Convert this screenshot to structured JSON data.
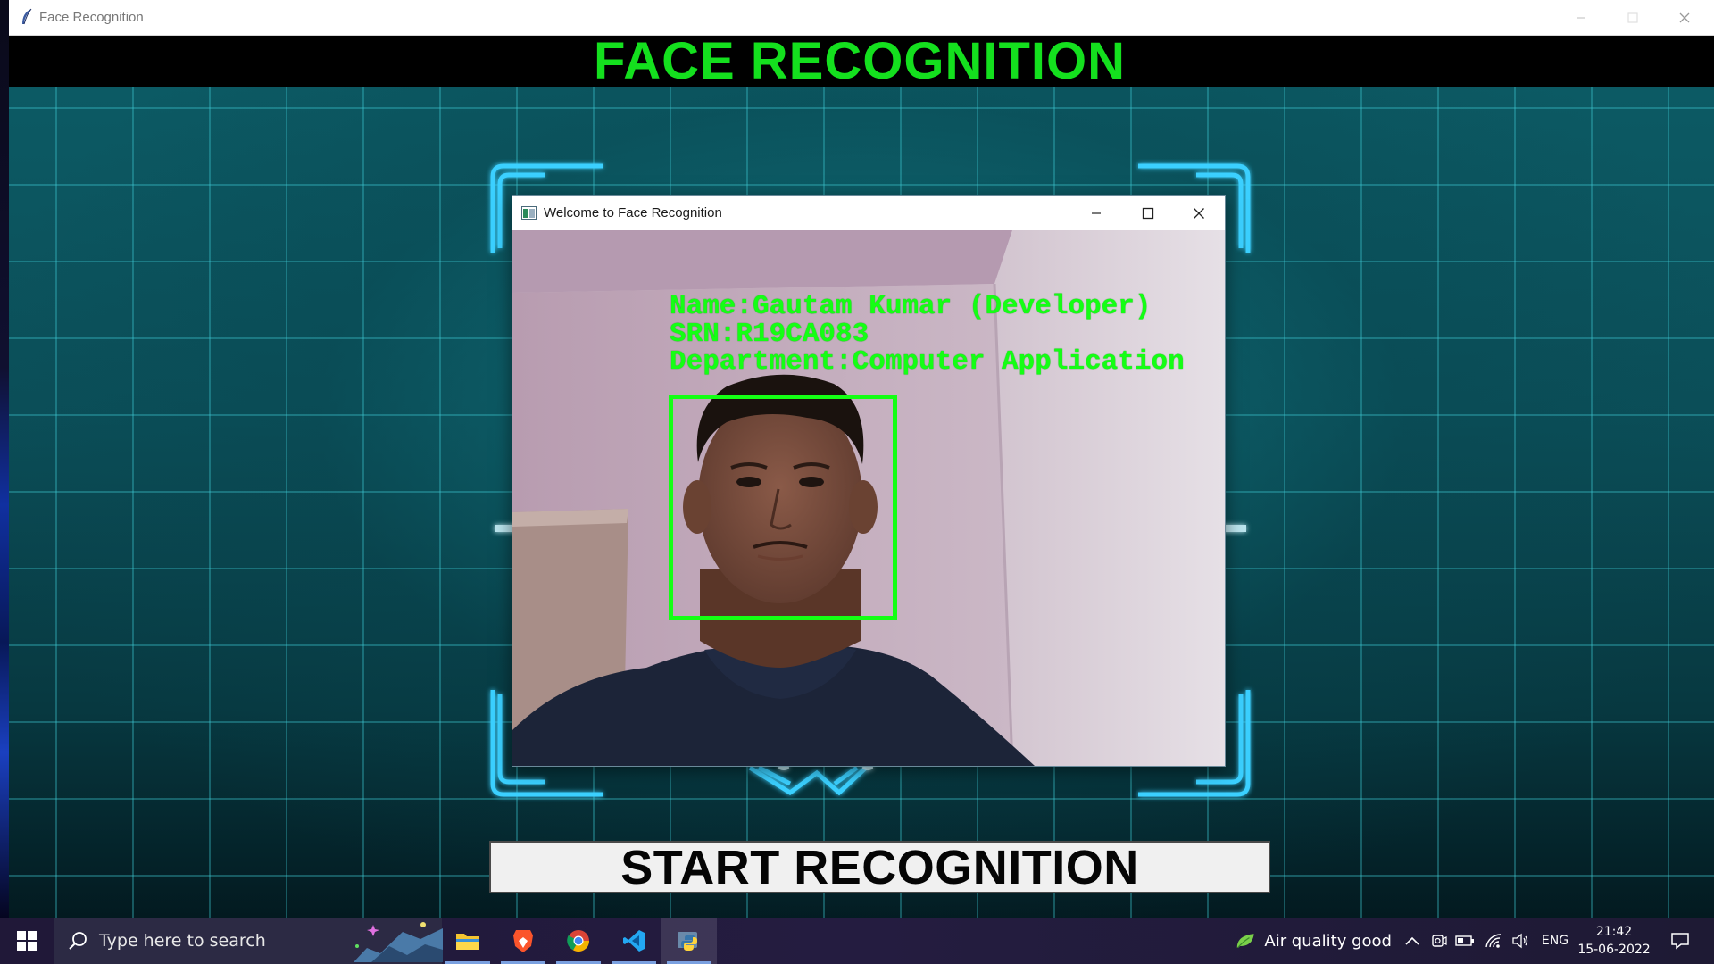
{
  "app_window": {
    "title": "Face Recognition",
    "banner_title": "FACE RECOGNITION",
    "start_button_label": "START RECOGNITION"
  },
  "cam_window": {
    "title": "Welcome to Face Recognition",
    "overlay": {
      "name_line": "Name:Gautam Kumar (Developer)",
      "srn_line": "SRN:R19CA083",
      "department_line": "Department:Computer Application"
    }
  },
  "taskbar": {
    "search_placeholder": "Type here to search",
    "apps": [
      "file-explorer-icon",
      "brave-browser-icon",
      "chrome-icon",
      "vscode-icon",
      "python-icon"
    ],
    "air_quality": "Air quality good",
    "language": "ENG",
    "time": "21:42",
    "date": "15-06-2022"
  },
  "colors": {
    "overlay_green": "#14ff14",
    "banner_green": "#14e01e",
    "frame_cyan": "#3ad0ff",
    "grid_teal": "#0c5a64"
  }
}
